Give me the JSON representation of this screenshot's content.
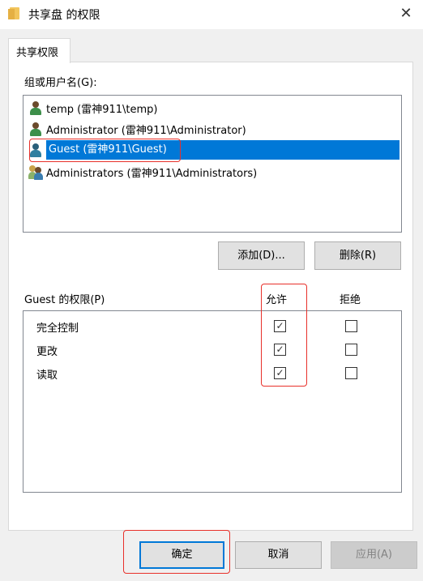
{
  "window": {
    "title": "共享盘 的权限",
    "close": "✕"
  },
  "tab": "共享权限",
  "users": {
    "label": "组或用户名(G):",
    "items": [
      {
        "name": "temp (雷神911\\temp)",
        "type": "user"
      },
      {
        "name": "Administrator (雷神911\\Administrator)",
        "type": "user"
      },
      {
        "name": "Guest (雷神911\\Guest)",
        "type": "guest",
        "selected": true
      },
      {
        "name": "Administrators (雷神911\\Administrators)",
        "type": "group"
      }
    ]
  },
  "buttons": {
    "add": "添加(D)...",
    "remove": "删除(R)",
    "ok": "确定",
    "cancel": "取消",
    "apply": "应用(A)"
  },
  "permissions": {
    "label": "Guest 的权限(P)",
    "allow": "允许",
    "deny": "拒绝",
    "items": [
      {
        "name": "完全控制",
        "allow": true,
        "deny": false
      },
      {
        "name": "更改",
        "allow": true,
        "deny": false
      },
      {
        "name": "读取",
        "allow": true,
        "deny": false
      }
    ]
  },
  "colors": {
    "selection": "#0078d7",
    "highlight": "#e8302a"
  }
}
